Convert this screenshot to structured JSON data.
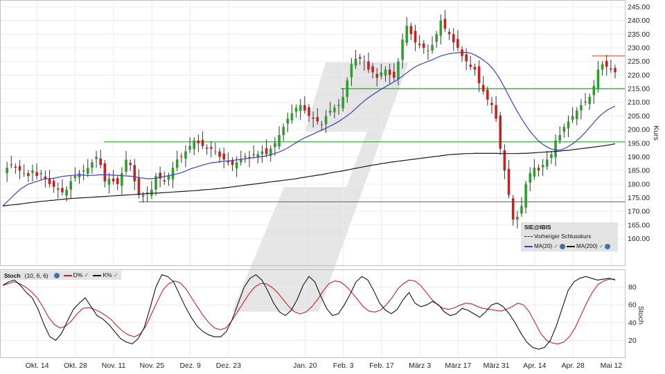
{
  "chart_data": [
    {
      "type": "candlestick",
      "symbol": "SIE@IBIS",
      "ylabel": "Kurs",
      "ylim": [
        150,
        247
      ],
      "y_ticks": [
        "160.00",
        "165.00",
        "170.00",
        "175.00",
        "180.00",
        "185.00",
        "190.00",
        "195.00",
        "200.00",
        "205.00",
        "210.00",
        "215.00",
        "220.00",
        "225.00",
        "230.00",
        "235.00",
        "240.00",
        "245.00"
      ],
      "x_ticks": [
        "Okt. 14",
        "Okt. 28",
        "Nov. 11",
        "Nov. 25",
        "Dez. 9",
        "Dez. 23",
        "Jan. 20",
        "Feb. 3",
        "Feb. 17",
        "März 3",
        "März 17",
        "März 31",
        "Apr. 14",
        "Apr. 28",
        "Mai 12"
      ],
      "x_tick_dates": [
        "2024-10-14",
        "2024-10-28",
        "2024-11-11",
        "2024-11-25",
        "2024-12-09",
        "2024-12-23",
        "2025-01-20",
        "2025-02-03",
        "2025-02-17",
        "2025-03-03",
        "2025-03-17",
        "2025-03-31",
        "2025-04-14",
        "2025-04-28",
        "2025-05-12"
      ],
      "horizontal_lines": [
        {
          "value": 215,
          "color": "#2e9e2e"
        },
        {
          "value": 195.5,
          "color": "#2e9e2e"
        },
        {
          "value": 173.5,
          "color": "#2e9e2e"
        },
        {
          "value": 227,
          "color": "#e0643c"
        }
      ],
      "close": [
        184,
        186,
        187,
        186,
        185,
        184,
        183,
        185,
        183,
        184,
        182,
        180,
        179,
        178,
        177,
        178,
        181,
        183,
        184,
        185,
        186,
        188,
        190,
        187,
        181,
        182,
        181,
        180,
        184,
        189,
        187,
        181,
        176,
        176,
        177,
        178,
        183,
        182,
        181,
        183,
        186,
        189,
        190,
        192,
        194,
        196,
        195,
        194,
        193,
        193,
        192,
        190,
        189,
        188,
        187,
        188,
        189,
        190,
        190,
        191,
        191,
        192,
        191,
        193,
        195,
        198,
        201,
        204,
        206,
        208,
        209,
        207,
        205,
        204,
        203,
        202,
        205,
        207,
        208,
        209,
        212,
        218,
        224,
        226,
        226,
        225,
        222,
        221,
        219,
        221,
        222,
        220,
        219,
        225,
        233,
        238,
        235,
        232,
        231,
        230,
        229,
        231,
        235,
        240,
        237,
        235,
        232,
        230,
        227,
        225,
        223,
        222,
        217,
        214,
        211,
        209,
        204,
        193,
        185,
        176,
        167,
        168,
        172,
        180,
        184,
        186,
        185,
        187,
        189,
        191,
        196,
        198,
        201,
        203,
        205,
        207,
        209,
        210,
        212,
        216,
        222,
        224,
        223,
        222,
        221
      ],
      "ma20": [
        172,
        173.5,
        175,
        176.5,
        178,
        179,
        180,
        180.5,
        181,
        181.5,
        182,
        182,
        182.2,
        182.5,
        182.8,
        183,
        183.2,
        183.3,
        183.4,
        183.3,
        183.2,
        183.2,
        183.3,
        183.5,
        183.4,
        183.4,
        183.3,
        183.2,
        183.1,
        183,
        182.9,
        182.7,
        182.4,
        182.2,
        182,
        182,
        182.2,
        182.5,
        182.8,
        183.1,
        183.4,
        183.8,
        184.2,
        184.8,
        185.5,
        186,
        186.5,
        187,
        187.4,
        187.8,
        188,
        188.2,
        188.4,
        188.5,
        188.7,
        188.9,
        189.1,
        189.3,
        189.5,
        189.7,
        189.9,
        190.1,
        190.4,
        190.8,
        191.3,
        191.8,
        192.5,
        193.3,
        194.2,
        195.2,
        196.2,
        197,
        197.7,
        198.4,
        199.1,
        199.8,
        200.5,
        201.3,
        202.1,
        203,
        204,
        205.1,
        206.3,
        207.7,
        209.2,
        210.5,
        211.7,
        212.8,
        213.8,
        214.8,
        215.7,
        216.6,
        217.5,
        218.5,
        219.6,
        220.8,
        222,
        223,
        223.8,
        224.4,
        225,
        225.6,
        226.3,
        227,
        227.4,
        227.8,
        228,
        228.2,
        228.3,
        228.3,
        228,
        227.4,
        226.5,
        225.5,
        224.3,
        222.8,
        220.7,
        218.2,
        215.4,
        212.4,
        209.4,
        206.6,
        204,
        201.6,
        199.4,
        197.5,
        195.8,
        194.6,
        193.6,
        192.9,
        192.5,
        192.5,
        193,
        193.8,
        194.8,
        196,
        197.4,
        199,
        200.8,
        202.6,
        204.4,
        205.8,
        207,
        207.9,
        208.6
      ],
      "ma200": [
        172,
        172.2,
        172.4,
        172.5,
        172.7,
        172.9,
        173.1,
        173.3,
        173.5,
        173.7,
        173.8,
        174,
        174.1,
        174.3,
        174.4,
        174.6,
        174.7,
        174.8,
        174.9,
        175,
        175.1,
        175.2,
        175.3,
        175.4,
        175.5,
        175.6,
        175.7,
        175.8,
        175.9,
        176,
        176.1,
        176.2,
        176.3,
        176.4,
        176.5,
        176.6,
        176.7,
        176.8,
        176.9,
        177,
        177.1,
        177.2,
        177.3,
        177.4,
        177.5,
        177.6,
        177.7,
        177.9,
        178,
        178.1,
        178.3,
        178.4,
        178.6,
        178.8,
        179,
        179.2,
        179.4,
        179.6,
        179.8,
        180,
        180.2,
        180.4,
        180.6,
        180.8,
        181,
        181.2,
        181.4,
        181.6,
        181.8,
        182,
        182.3,
        182.5,
        182.8,
        183,
        183.3,
        183.5,
        183.8,
        184.1,
        184.4,
        184.6,
        184.9,
        185.2,
        185.5,
        185.8,
        186.1,
        186.4,
        186.7,
        187,
        187.2,
        187.5,
        187.7,
        188,
        188.2,
        188.4,
        188.6,
        188.8,
        189,
        189.2,
        189.4,
        189.6,
        189.8,
        190,
        190.2,
        190.4,
        190.6,
        190.8,
        190.9,
        191,
        191.1,
        191.2,
        191.2,
        191.3,
        191.3,
        191.3,
        191.3,
        191.3,
        191.3,
        191.2,
        191.2,
        191.2,
        191.2,
        191.2,
        191.3,
        191.3,
        191.4,
        191.5,
        191.6,
        191.7,
        191.8,
        191.9,
        192,
        192.1,
        192.3,
        192.4,
        192.6,
        192.8,
        193,
        193.2,
        193.4,
        193.6,
        193.8,
        194,
        194.2,
        194.5,
        194.8
      ],
      "legend": {
        "title": "SIE@IBIS",
        "items": [
          "Vorheriger Schlusskurs",
          "MA(20)",
          "MA(200)"
        ],
        "colors": {
          "ma20": "#3a3ec0",
          "ma200": "#1a1a1a",
          "up": "#2e9e2e",
          "down": "#cc2020"
        }
      }
    },
    {
      "type": "line",
      "title": "Stoch",
      "params": "(10, 6, 6)",
      "ylabel": "Stoch",
      "ylim": [
        0,
        100
      ],
      "y_ticks": [
        "20",
        "40",
        "60",
        "80"
      ],
      "series": [
        {
          "name": "D%",
          "color": "#cc2020",
          "values": [
            82,
            84,
            86,
            84,
            80,
            75,
            68,
            58,
            46,
            38,
            34,
            36,
            42,
            50,
            56,
            57,
            55,
            52,
            48,
            43,
            36,
            30,
            26,
            24,
            27,
            36,
            50,
            64,
            77,
            84,
            87,
            85,
            78,
            68,
            58,
            48,
            40,
            34,
            32,
            34,
            42,
            52,
            62,
            72,
            80,
            84,
            84,
            80,
            74,
            66,
            58,
            52,
            50,
            52,
            58,
            66,
            76,
            84,
            87,
            86,
            81,
            74,
            66,
            58,
            53,
            52,
            54,
            60,
            68,
            78,
            84,
            88,
            87,
            82,
            74,
            66,
            60,
            56,
            55,
            57,
            60,
            62,
            61,
            58,
            56,
            55,
            54,
            53,
            55,
            58,
            62,
            60,
            52,
            40,
            28,
            20,
            17,
            16,
            18,
            24,
            34,
            48,
            62,
            74,
            83,
            87,
            89,
            89
          ]
        },
        {
          "name": "K%",
          "color": "#111111",
          "values": [
            82,
            86,
            88,
            82,
            74,
            68,
            55,
            38,
            24,
            20,
            28,
            42,
            55,
            62,
            68,
            58,
            48,
            44,
            38,
            30,
            22,
            18,
            16,
            22,
            34,
            56,
            80,
            94,
            92,
            86,
            72,
            58,
            46,
            36,
            30,
            26,
            24,
            24,
            30,
            44,
            62,
            80,
            90,
            94,
            88,
            76,
            62,
            52,
            48,
            54,
            66,
            82,
            92,
            86,
            70,
            56,
            48,
            50,
            60,
            72,
            86,
            92,
            88,
            76,
            62,
            54,
            50,
            55,
            66,
            74,
            62,
            58,
            60,
            64,
            60,
            52,
            48,
            50,
            56,
            54,
            50,
            46,
            52,
            60,
            62,
            58,
            50,
            40,
            28,
            18,
            12,
            10,
            12,
            20,
            36,
            56,
            76,
            86,
            90,
            92,
            90,
            88,
            89,
            90,
            88
          ]
        }
      ]
    }
  ]
}
